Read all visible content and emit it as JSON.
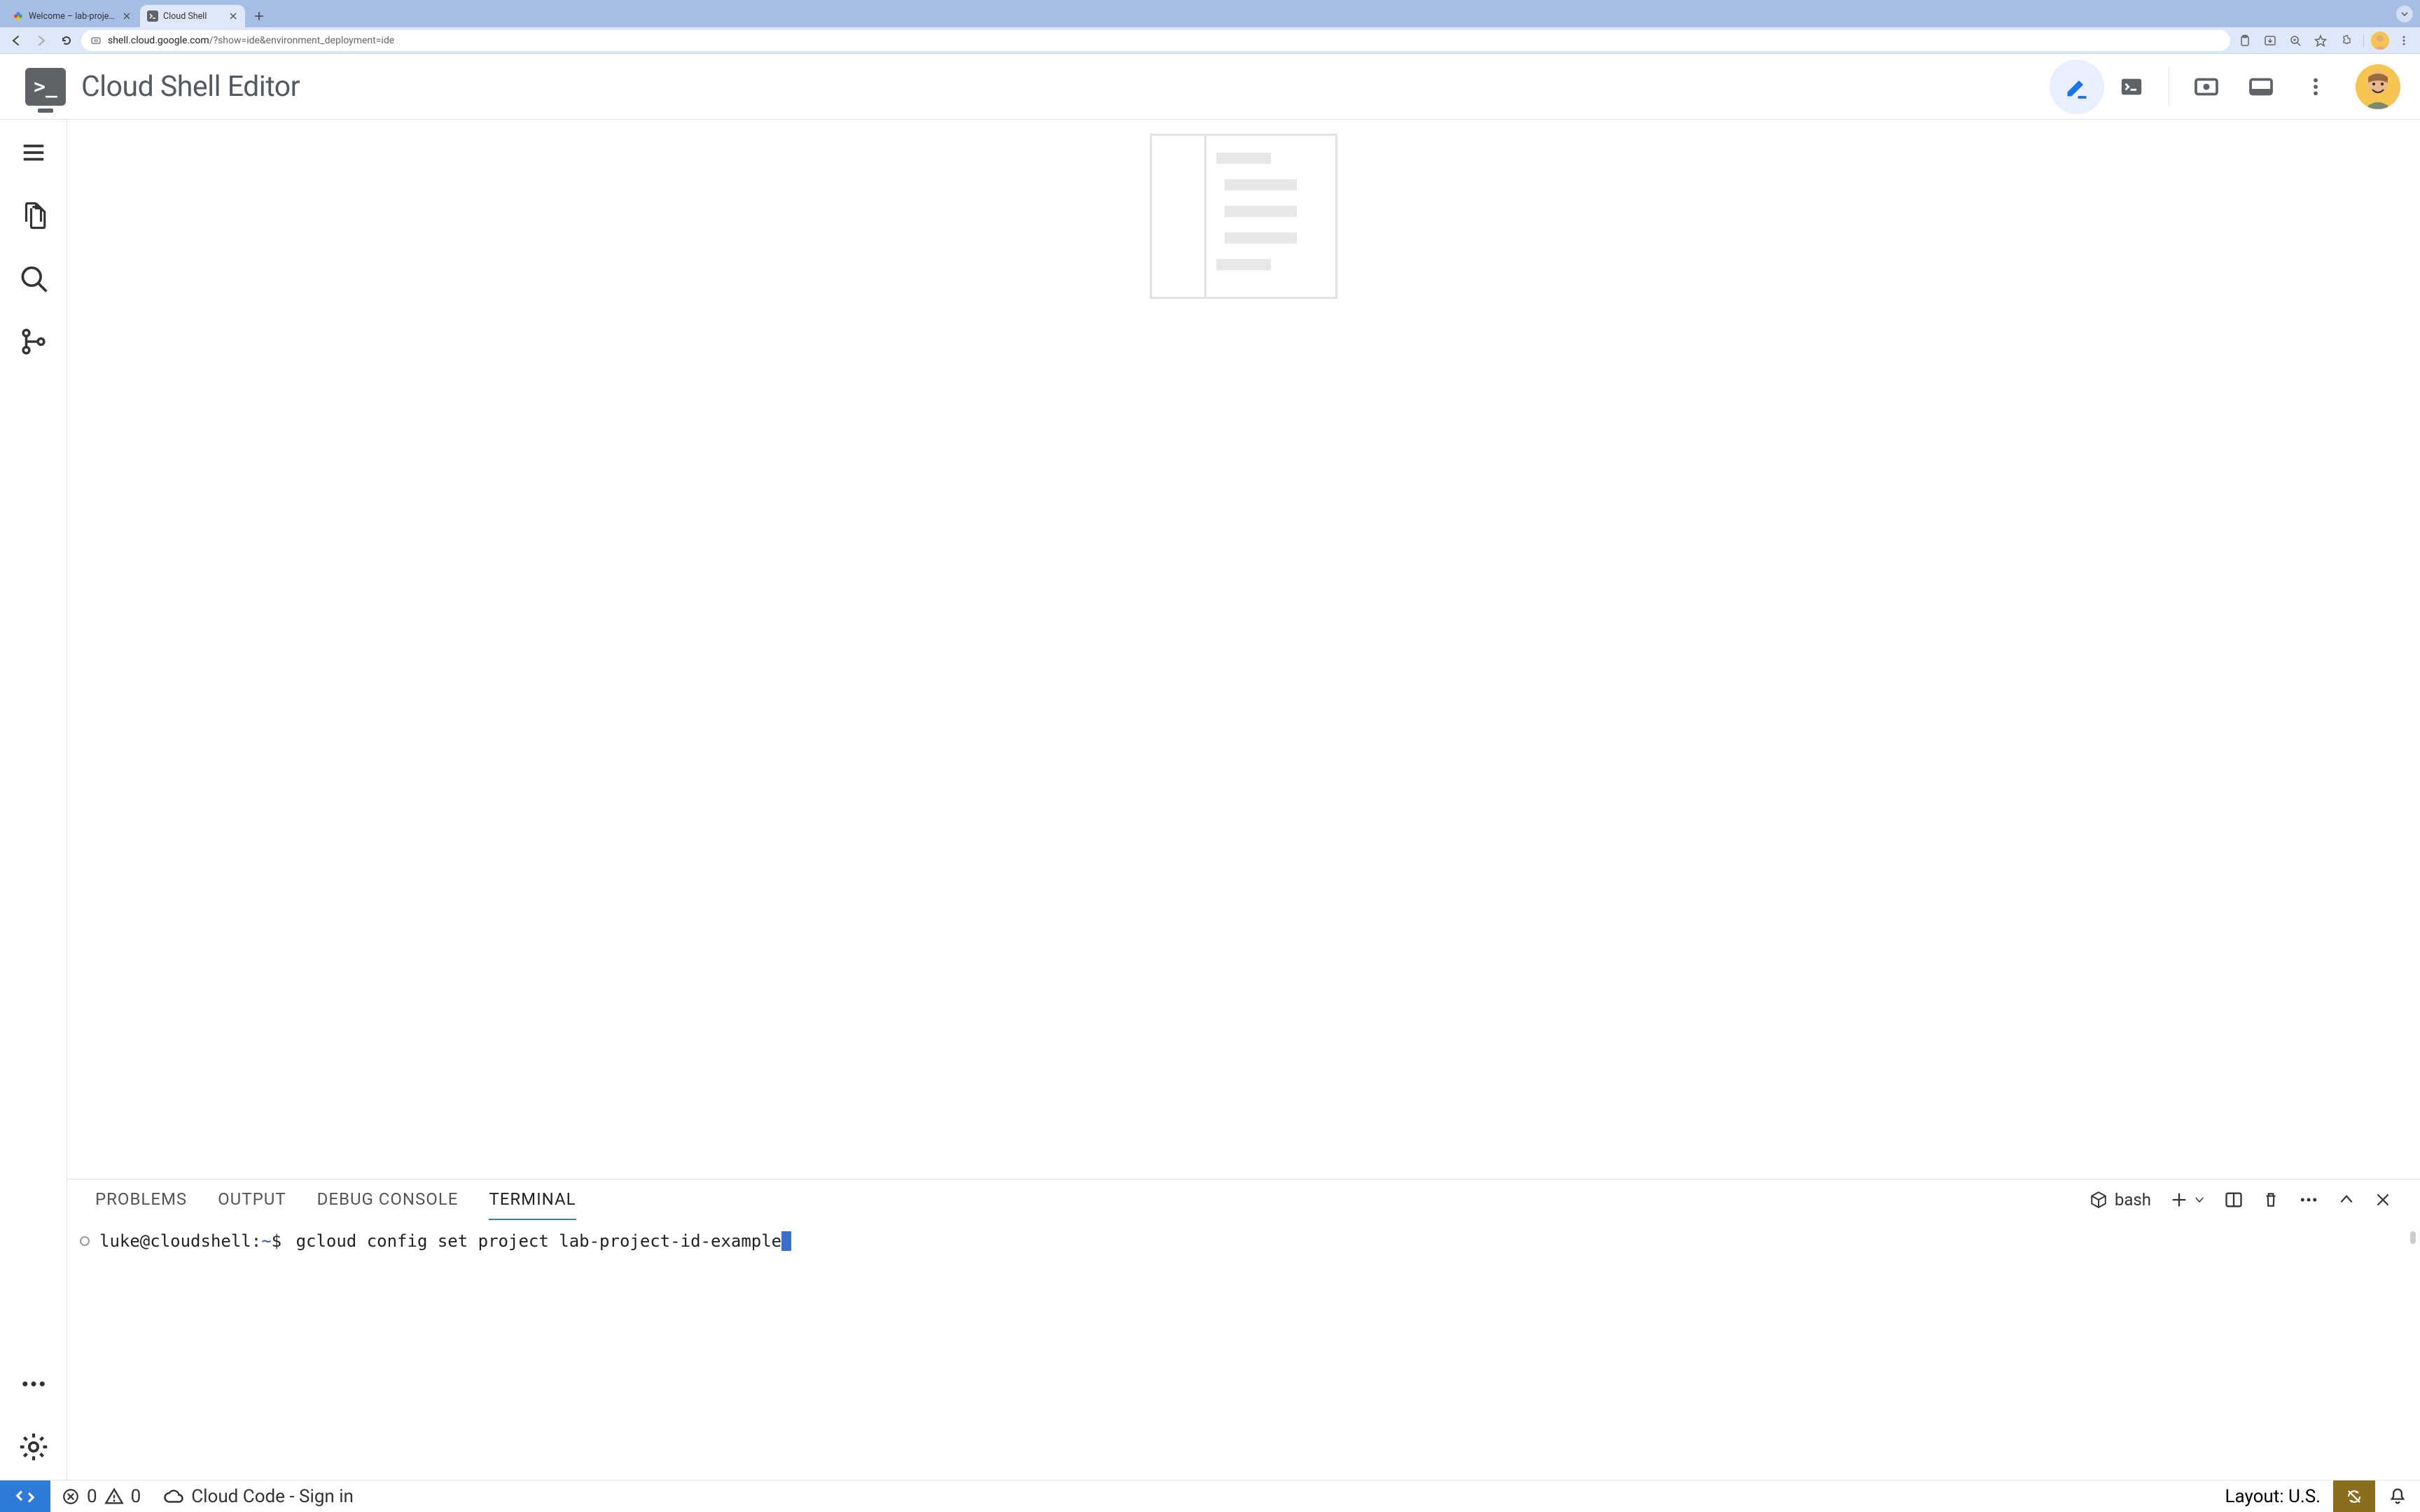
{
  "browser": {
    "tabs": [
      {
        "title": "Welcome – lab-project-id-ex",
        "active": false
      },
      {
        "title": "Cloud Shell",
        "active": true
      }
    ],
    "url_domain": "shell.cloud.google.com",
    "url_path": "/?show=ide&environment_deployment=ide"
  },
  "header": {
    "title": "Cloud Shell Editor"
  },
  "panel": {
    "tabs": [
      "PROBLEMS",
      "OUTPUT",
      "DEBUG CONSOLE",
      "TERMINAL"
    ],
    "active_tab": "TERMINAL",
    "shell_name": "bash"
  },
  "terminal": {
    "user": "luke@cloudshell",
    "sep": ":",
    "path": "~",
    "prompt": "$",
    "command": "gcloud config set project lab-project-id-example"
  },
  "status": {
    "errors": "0",
    "warnings": "0",
    "cloud_code": "Cloud Code - Sign in",
    "layout": "Layout: U.S."
  }
}
